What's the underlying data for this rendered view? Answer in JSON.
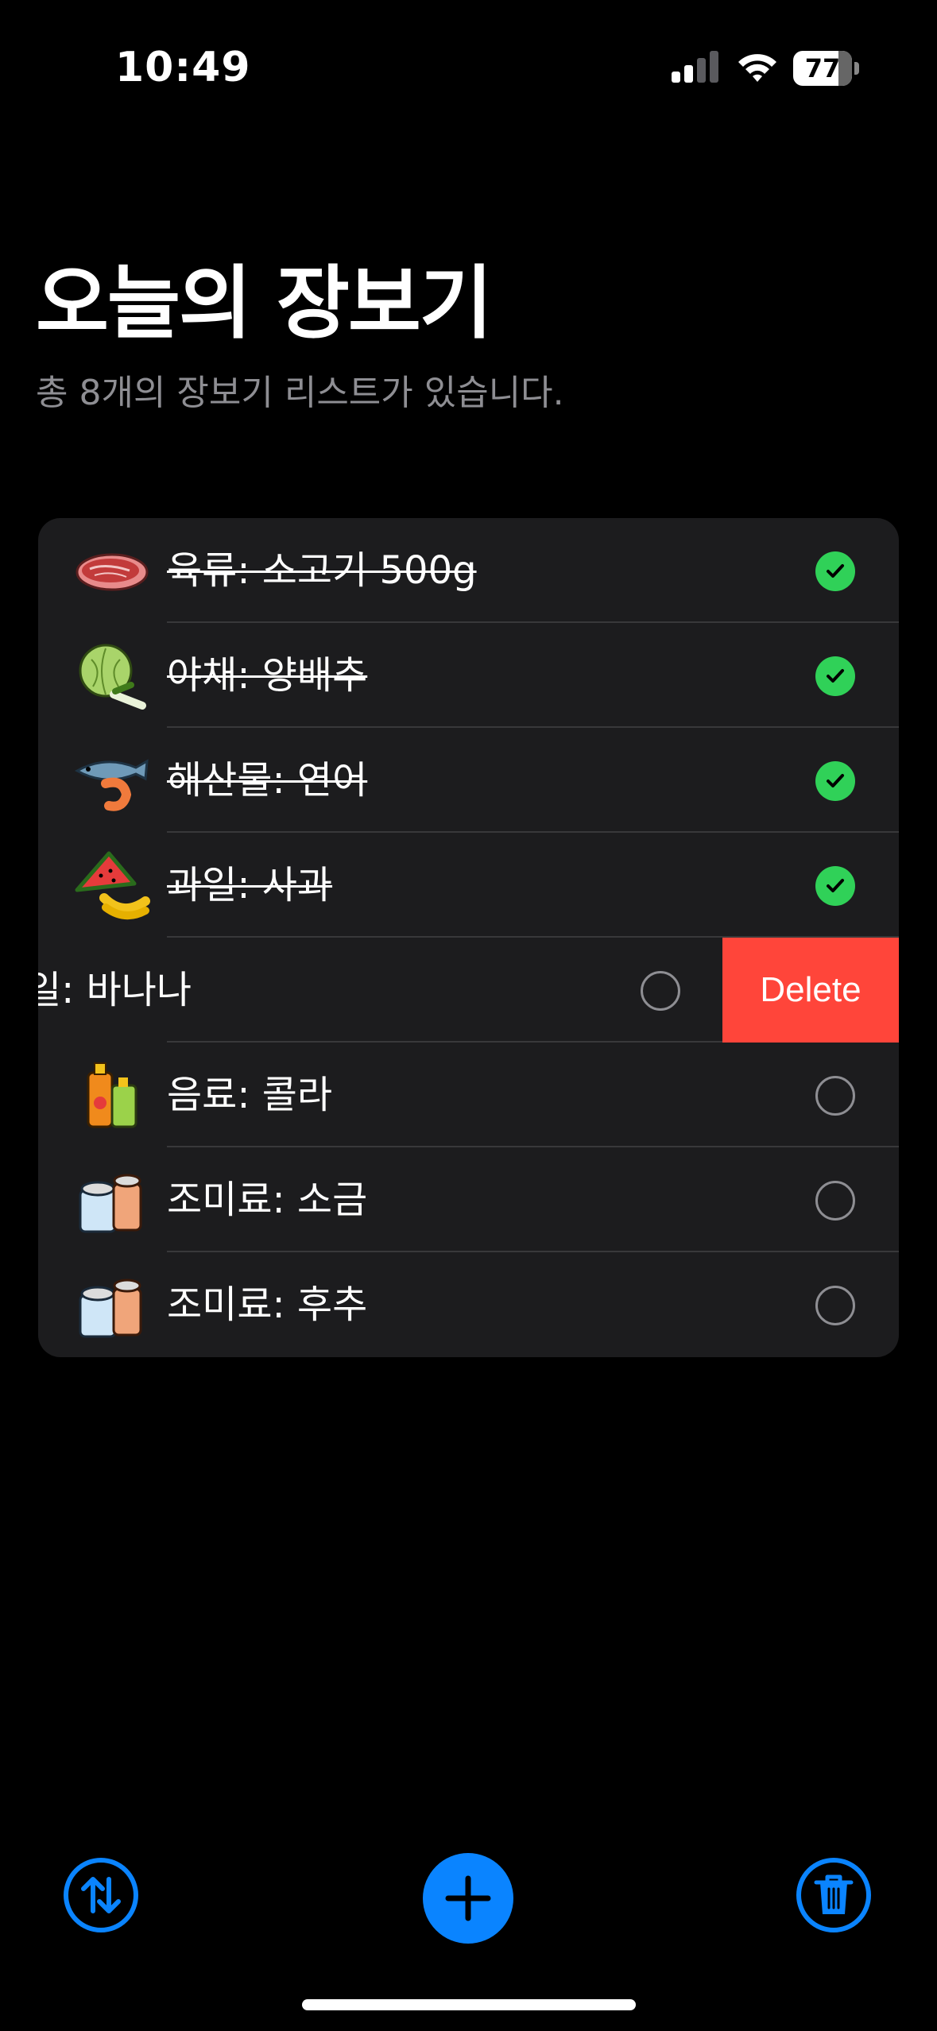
{
  "status_bar": {
    "time": "10:49",
    "battery": "77"
  },
  "header": {
    "title": "오늘의 장보기",
    "subtitle": "총 8개의 장보기 리스트가 있습니다."
  },
  "items": [
    {
      "label": "육류: 소고기 500g",
      "done": true,
      "icon": "meat-icon"
    },
    {
      "label": "야채: 양배추",
      "done": true,
      "icon": "vegetable-icon"
    },
    {
      "label": "해산물: 연어",
      "done": true,
      "icon": "seafood-icon"
    },
    {
      "label": "과일: 사과",
      "done": true,
      "icon": "fruit-icon"
    },
    {
      "label": "과일: 바나나",
      "visible_label": "일: 바나나",
      "done": false,
      "swiped": true,
      "icon": "fruit-icon"
    },
    {
      "label": "음료: 콜라",
      "done": false,
      "icon": "beverage-icon"
    },
    {
      "label": "조미료: 소금",
      "done": false,
      "icon": "seasoning-icon"
    },
    {
      "label": "조미료: 후추",
      "done": false,
      "icon": "seasoning-icon"
    }
  ],
  "swipe_action": {
    "label": "Delete",
    "color": "#ff453a"
  },
  "toolbar": {
    "sort_icon": "sort-arrows-icon",
    "add_icon": "plus-icon",
    "trash_icon": "trash-icon"
  },
  "colors": {
    "accent": "#0a84ff",
    "done": "#30d158",
    "card": "#1c1c1e",
    "destructive": "#ff453a"
  }
}
